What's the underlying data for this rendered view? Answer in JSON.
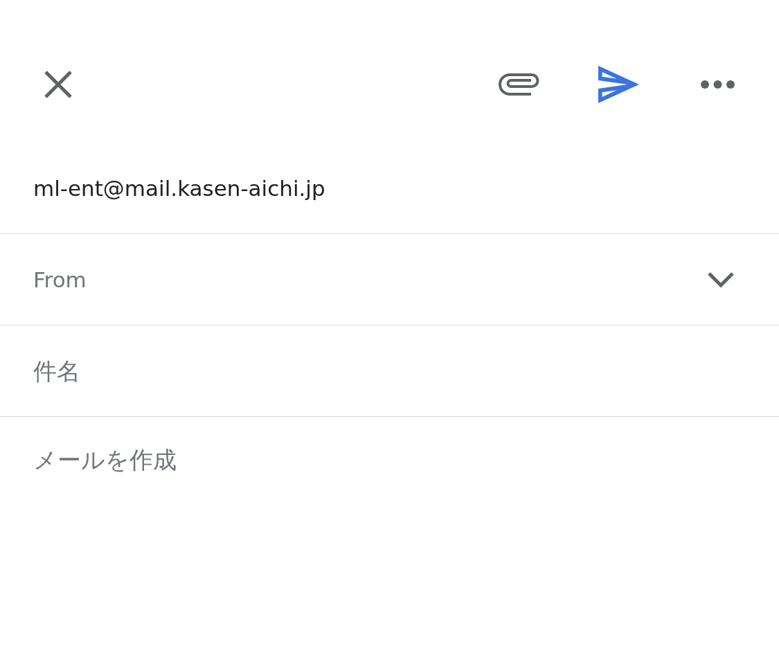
{
  "toolbar": {
    "send_enabled": true
  },
  "to": {
    "value": "ml-ent@mail.kasen-aichi.jp"
  },
  "from": {
    "label": "From",
    "expanded": false
  },
  "subject": {
    "placeholder": "件名"
  },
  "body": {
    "placeholder": "メールを作成"
  }
}
